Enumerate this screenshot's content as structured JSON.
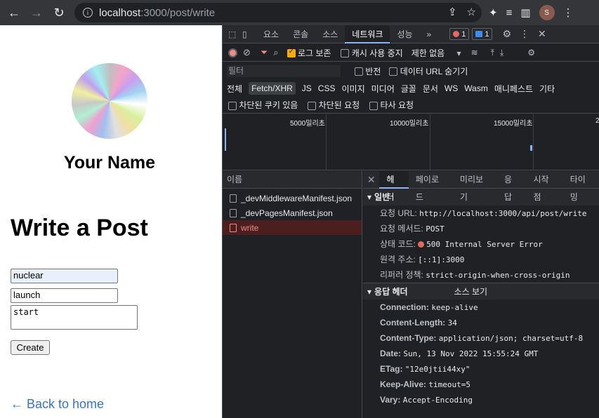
{
  "browser": {
    "url_host": "localhost",
    "url_path": ":3000/post/write",
    "profile_initial": "S"
  },
  "page": {
    "profile_name": "Your Name",
    "heading": "Write a Post",
    "fields": [
      "nuclear",
      "launch"
    ],
    "textarea_value": "start",
    "create_label": "Create",
    "back_link": "← Back to home"
  },
  "devtools": {
    "tabs": [
      "요소",
      "콘솔",
      "소스",
      "네트워크",
      "성능",
      "»"
    ],
    "active_tab": "네트워크",
    "errors_badge": "1",
    "messages_badge": "1",
    "toolbar": {
      "preserve_log": "로그 보존",
      "disable_cache": "캐시 사용 중지",
      "throttle": "제한 없음"
    },
    "filter": {
      "placeholder": "필터",
      "invert": "반전",
      "hide_data_urls": "데이터 URL 숨기기"
    },
    "types": [
      "전체",
      "Fetch/XHR",
      "JS",
      "CSS",
      "이미지",
      "미디어",
      "글꼴",
      "문서",
      "WS",
      "Wasm",
      "매니페스트",
      "기타"
    ],
    "selected_type": "Fetch/XHR",
    "blocked": [
      "차단된 쿠키 있음",
      "차단된 요청",
      "타사 요청"
    ],
    "timeline_labels": [
      "5000밀리초",
      "10000밀리초",
      "15000밀리초",
      "2"
    ],
    "name_header": "이름",
    "requests": [
      {
        "name": "_devMiddlewareManifest.json",
        "error": false
      },
      {
        "name": "_devPagesManifest.json",
        "error": false
      },
      {
        "name": "write",
        "error": true
      }
    ],
    "detail_tabs": [
      "헤더",
      "페이로드",
      "미리보기",
      "응답",
      "시작점",
      "타이밍"
    ],
    "general": {
      "title": "일반",
      "rows": [
        {
          "k": "요청 URL:",
          "v": "http://localhost:3000/api/post/write"
        },
        {
          "k": "요청 메서드:",
          "v": "POST"
        },
        {
          "k": "상태 코드:",
          "v": "500 Internal Server Error",
          "status": true
        },
        {
          "k": "원격 주소:",
          "v": "[::1]:3000"
        },
        {
          "k": "리퍼러 정책:",
          "v": "strict-origin-when-cross-origin"
        }
      ]
    },
    "response": {
      "title": "응답 헤더",
      "view_source": "소스 보기",
      "rows": [
        {
          "k": "Connection:",
          "v": "keep-alive"
        },
        {
          "k": "Content-Length:",
          "v": "34"
        },
        {
          "k": "Content-Type:",
          "v": "application/json; charset=utf-8"
        },
        {
          "k": "Date:",
          "v": "Sun, 13 Nov 2022 15:55:24 GMT"
        },
        {
          "k": "ETag:",
          "v": "\"12e0jtii44xy\""
        },
        {
          "k": "Keep-Alive:",
          "v": "timeout=5"
        },
        {
          "k": "Vary:",
          "v": "Accept-Encoding"
        }
      ]
    }
  }
}
